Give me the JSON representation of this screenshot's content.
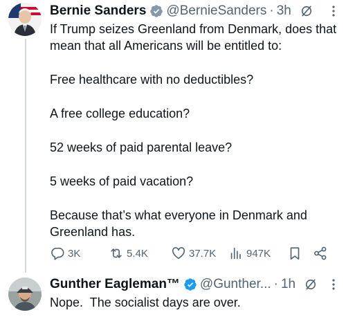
{
  "tweet1": {
    "name": "Bernie Sanders",
    "handle": "@BernieSanders",
    "dot": "·",
    "time": "3h",
    "paragraphs": [
      "If Trump seizes Greenland from Denmark, does that mean that all Americans will be entitled to:",
      "Free healthcare with no deductibles?",
      "A free college education?",
      "52 weeks of paid parental leave?",
      "5 weeks of paid vacation?",
      "Because that’s what everyone in Denmark and Greenland has."
    ],
    "actions": {
      "replies": "3K",
      "retweets": "5.4K",
      "likes": "37.7K",
      "views": "947K"
    }
  },
  "tweet2": {
    "name": "Gunther Eagleman™",
    "handle": "@Gunther...",
    "dot": "·",
    "time": "1h",
    "text": "Nope.  The socialist days are over."
  },
  "colors": {
    "verified": "#1d9bf0",
    "secondary_text": "#536471",
    "thread_line": "#cfd9de"
  }
}
